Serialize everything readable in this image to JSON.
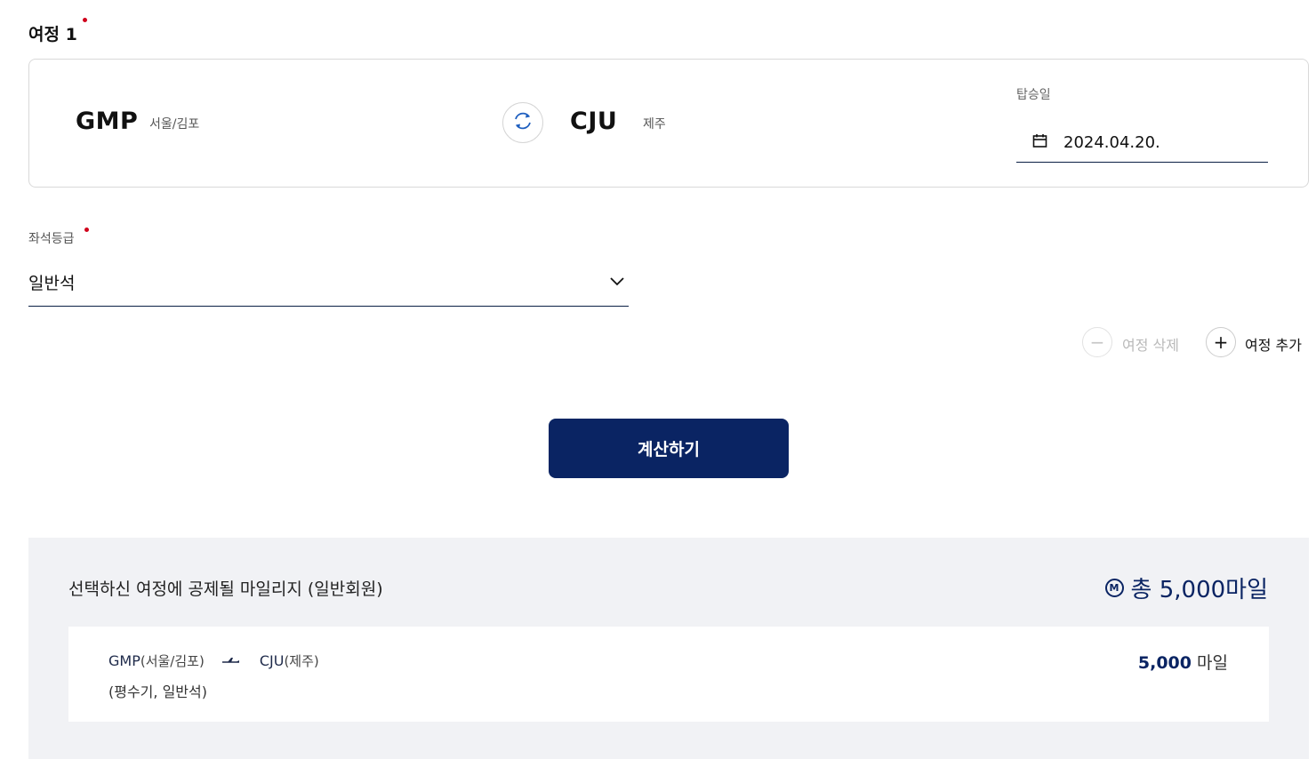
{
  "journey": {
    "title": "여정 1",
    "required_color": "#d0021b",
    "origin": {
      "code": "GMP",
      "city": "서울/김포"
    },
    "destination": {
      "code": "CJU",
      "city": "제주"
    },
    "swap_icon": "swap-arrows-icon",
    "date_label": "탑승일",
    "date_value": "2024.04.20.",
    "date_icon": "calendar-icon"
  },
  "seat": {
    "label": "좌석등급",
    "value": "일반석",
    "dropdown_icon": "chevron-down-icon"
  },
  "actions": {
    "remove_label": "여정 삭제",
    "add_label": "여정 추가",
    "remove_symbol": "−",
    "add_symbol": "+"
  },
  "calculate_label": "계산하기",
  "result": {
    "title": "선택하신 여정에 공제될 마일리지 (일반회원)",
    "total_badge": "M",
    "total_text": "총 5,000마일",
    "route": {
      "from_code": "GMP",
      "from_city": "(서울/김포)",
      "to_code": "CJU",
      "to_city": "(제주)",
      "note": "(평수기, 일반석)",
      "miles_value": "5,000",
      "miles_unit": "마일"
    }
  },
  "colors": {
    "brand_navy": "#0a2463",
    "panel_bg": "#f1f2f5"
  }
}
